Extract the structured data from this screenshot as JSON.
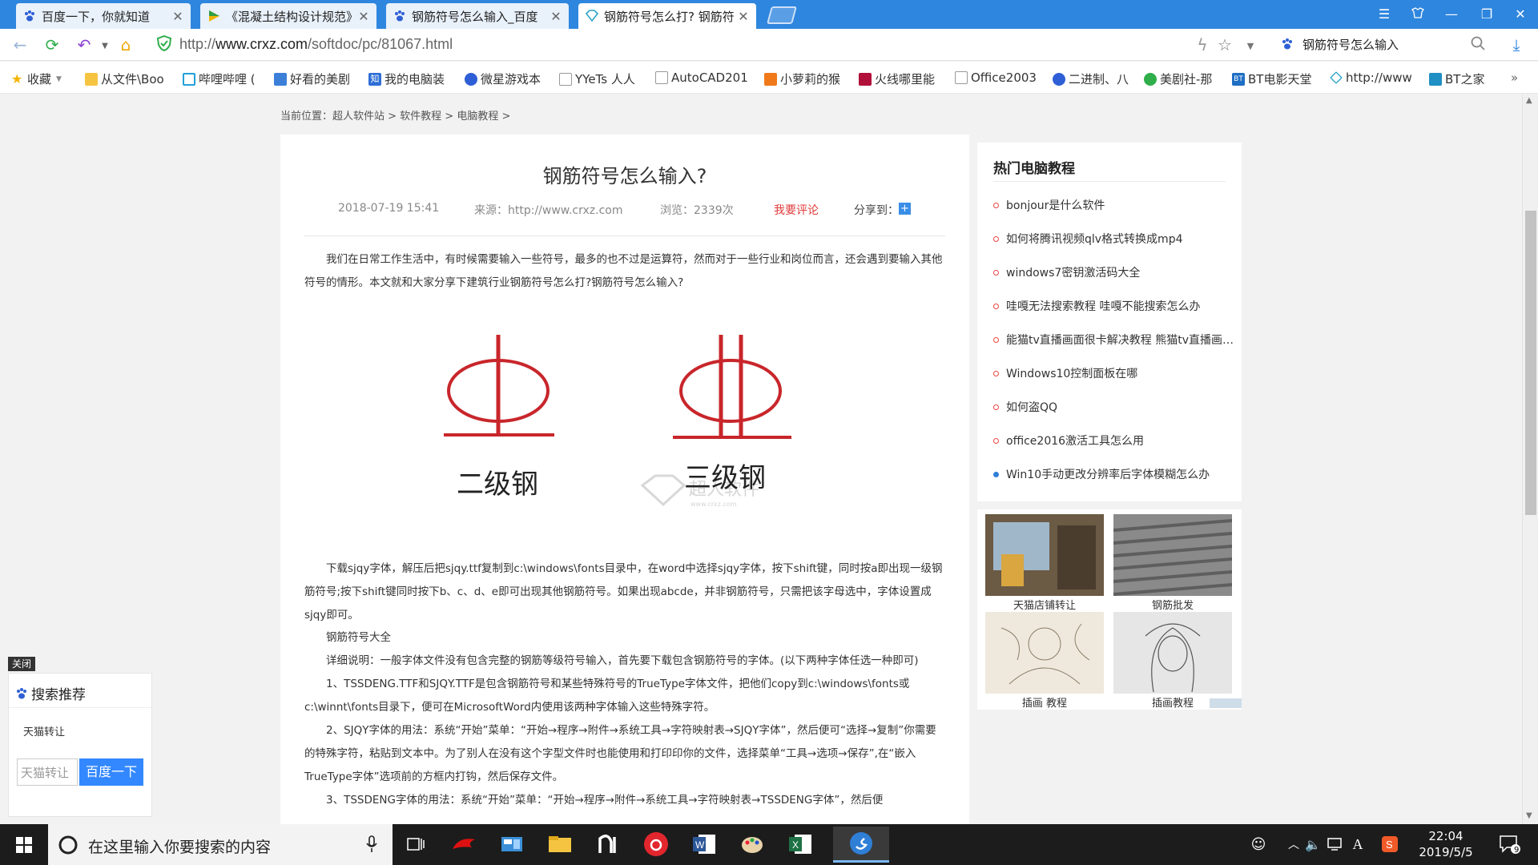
{
  "browser": {
    "tabs": [
      {
        "title": "百度一下，你就知道"
      },
      {
        "title": "《混凝土结构设计规范》"
      },
      {
        "title": "钢筋符号怎么输入_百度"
      },
      {
        "title": "钢筋符号怎么打? 钢筋符"
      }
    ],
    "url_prefix": "http://",
    "url_domain": "www.crxz.com",
    "url_path": "/softdoc/pc/81067.html",
    "search_box_text": "钢筋符号怎么输入",
    "bookmarks": [
      "收藏",
      "从文件\\Boo",
      "哔哩哔哩 (",
      "好看的美剧",
      "我的电脑装",
      "微星游戏本",
      "YYeTs 人人",
      "AutoCAD201",
      "小萝莉的猴",
      "火线哪里能",
      "Office2003",
      "二进制、八",
      "美剧社-那",
      "BT电影天堂",
      "http://www",
      "BT之家"
    ]
  },
  "page": {
    "breadcrumb": "当前位置：超人软件站 > 软件教程 > 电脑教程 >",
    "article": {
      "title": "钢筋符号怎么输入?",
      "date": "2018-07-19 15:41",
      "source": "来源：http://www.crxz.com",
      "views": "浏览：2339次",
      "comment": "我要评论",
      "share": "分享到：",
      "paragraphs": [
        "我们在日常工作生活中，有时候需要输入一些符号，最多的也不过是运算符，然而对于一些行业和岗位而言，还会遇到要输入其他符号的情形。本文就和大家分享下建筑行业钢筋符号怎么打?钢筋符号怎么输入?",
        "下载sjqy字体，解压后把sjqy.ttf复制到c:\\windows\\fonts目录中，在word中选择sjqy字体，按下shift键，同时按a即出现一级钢筋符号;按下shift键同时按下b、c、d、e即可出现其他钢筋符号。如果出现abcde，并非钢筋符号，只需把该字母选中，字体设置成sjqy即可。",
        "钢筋符号大全",
        "详细说明：一般字体文件没有包含完整的钢筋等级符号输入，首先要下载包含钢筋符号的字体。(以下两种字体任选一种即可)",
        "1、TSSDENG.TTF和SJQY.TTF是包含钢筋符号和某些特殊符号的TrueType字体文件，把他们copy到c:\\windows\\fonts或c:\\winnt\\fonts目录下，便可在MicrosoftWord内使用该两种字体输入这些特殊字符。",
        "2、SJQY字体的用法：系统“开始”菜单：“开始→程序→附件→系统工具→字符映射表→SJQY字体”，然后便可“选择→复制”你需要的特殊字符，粘贴到文本中。为了别人在没有这个字型文件时也能使用和打印印你的文件，选择菜单“工具→选项→保存”,在“嵌入TrueType字体”选项前的方框内打钩，然后保存文件。",
        "3、TSSDENG字体的用法：系统“开始”菜单：“开始→程序→附件→系统工具→字符映射表→TSSDENG字体”，然后便"
      ],
      "figure": {
        "label_left": "二级钢",
        "label_right": "三级钢",
        "watermark": "超人软件",
        "watermark_sub": "www.crxz.com"
      }
    },
    "sidebar": {
      "hot_title": "热门电脑教程",
      "hot_items": [
        "bonjour是什么软件",
        "如何将腾讯视频qlv格式转换成mp4",
        "windows7密钥激活码大全",
        "哇嘎无法搜索教程 哇嘎不能搜索怎么办",
        "能猫tv直播画面很卡解决教程 熊猫tv直播画面卡",
        "Windows10控制面板在哪",
        "如何盗QQ",
        "office2016激活工具怎么用",
        "Win10手动更改分辨率后字体模糊怎么办"
      ],
      "ads": [
        "天猫店铺转让",
        "钢筋批发",
        "插画 教程",
        "插画教程"
      ]
    },
    "float_search": {
      "close": "关闭",
      "title": "搜索推荐",
      "item": "天猫转让",
      "input_value": "天猫转让",
      "button": "百度一下"
    }
  },
  "taskbar": {
    "search_placeholder": "在这里输入你要搜索的内容",
    "time": "22:04",
    "date": "2019/5/5",
    "notifications": "9"
  },
  "colors": {
    "tab_strip": "#2e86de",
    "rebar_red": "#c8262b",
    "comment_red": "#e03a3a",
    "baidu_blue": "#3388ff"
  }
}
